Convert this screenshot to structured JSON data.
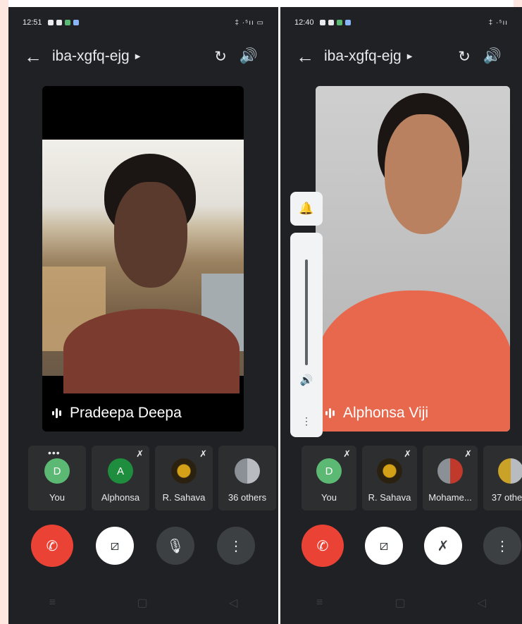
{
  "left_screen": {
    "status": {
      "time": "12:51",
      "right": "‡ ·⁵ıı ▭"
    },
    "meeting_code": "iba-xgfq-ejg",
    "featured": {
      "name": "Pradeepa Deepa"
    },
    "participants": [
      {
        "initial": "D",
        "name": "You",
        "avatar_color": "#5bb974",
        "muted": false,
        "more": true
      },
      {
        "initial": "A",
        "name": "Alphonsa",
        "avatar_color": "#1e8e3e",
        "muted": true
      },
      {
        "initial": "",
        "name": "R. Sahava",
        "avatar_color": "#3a2f16",
        "muted": true
      },
      {
        "initial": "",
        "name": "36 others",
        "avatar_color": "#7a7f86",
        "muted": false
      }
    ]
  },
  "right_screen": {
    "status": {
      "time": "12:40",
      "right": "‡ ·⁵ıı"
    },
    "meeting_code": "iba-xgfq-ejg",
    "featured": {
      "name": "Alphonsa Viji"
    },
    "participants": [
      {
        "initial": "D",
        "name": "You",
        "avatar_color": "#5bb974",
        "muted": true
      },
      {
        "initial": "",
        "name": "R. Sahava",
        "avatar_color": "#3a2f16",
        "muted": true
      },
      {
        "initial": "",
        "name": "Mohame...",
        "avatar_color": "#7a7f86",
        "muted": true
      },
      {
        "initial": "",
        "name": "37 others",
        "avatar_color": "#8a7a4a",
        "muted": false
      }
    ]
  },
  "icons": {
    "back": "←",
    "caret": "▶",
    "switch_camera": "↻",
    "speaker": "🔊",
    "mic_muted": "✗",
    "end_call": "✆",
    "camera_off": "⧄",
    "mic": "🎙",
    "more": "⋮",
    "bell": "🔔",
    "nav_recent": "≡",
    "nav_home": "▢",
    "nav_back": "◁"
  },
  "colors": {
    "end_call": "#ea4335",
    "bg": "#202124",
    "tile": "#2d2e30"
  }
}
